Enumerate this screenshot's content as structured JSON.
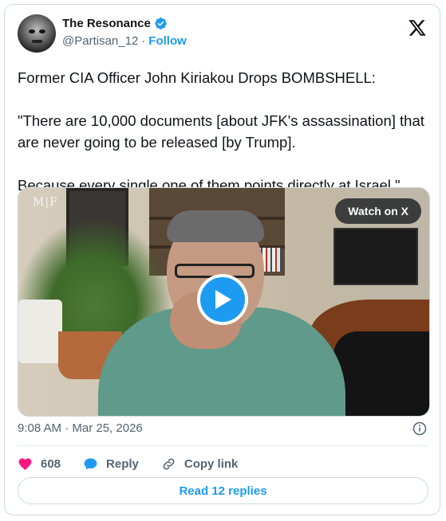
{
  "author": {
    "name": "The Resonance",
    "handle": "@Partisan_12",
    "separator": "·",
    "follow_label": "Follow",
    "verified": true
  },
  "tweet": {
    "text": "Former CIA Officer John Kiriakou Drops BOMBSHELL:\n\n\"There are 10,000 documents [about JFK's assassination] that are never going to be released [by Trump].\n\nBecause every single one of them points directly at Israel.\""
  },
  "media": {
    "type": "video",
    "watermark": "M|F",
    "watch_label": "Watch on X"
  },
  "meta": {
    "timestamp": "9:08 AM · Mar 25, 2026"
  },
  "actions": {
    "like_count": "608",
    "reply_label": "Reply",
    "copy_link_label": "Copy link"
  },
  "footer": {
    "read_replies_label": "Read 12 replies"
  },
  "icons": {
    "x_logo": "x-logo-icon",
    "verified": "verified-badge-icon",
    "info": "info-icon",
    "heart": "heart-icon",
    "reply": "reply-bubble-icon",
    "link": "link-icon",
    "play": "play-icon"
  },
  "colors": {
    "accent": "#1d9bf0",
    "heart": "#f91880",
    "text_primary": "#0f1419",
    "text_secondary": "#536471",
    "border": "#cfd9de"
  }
}
